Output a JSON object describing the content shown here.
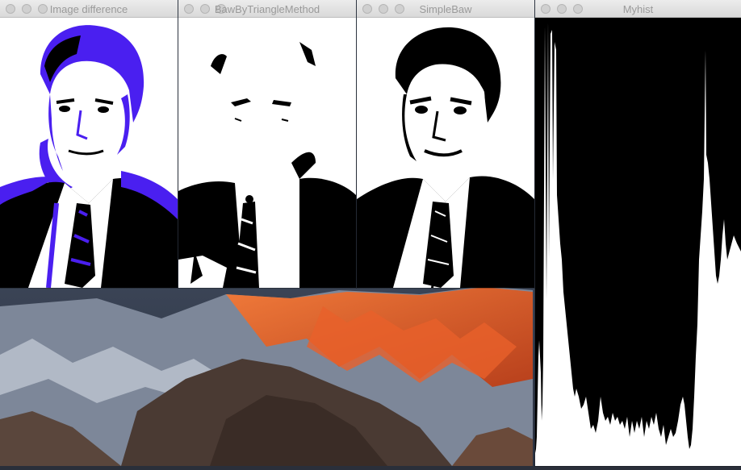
{
  "windows": [
    {
      "title": "Image difference",
      "image": "portrait-difference-blue-black"
    },
    {
      "title": "BawByTriangleMethod",
      "image": "portrait-triangle-threshold"
    },
    {
      "title": "SimpleBaw",
      "image": "portrait-simple-threshold"
    },
    {
      "title": "Myhist",
      "image": "grayscale-histogram"
    }
  ],
  "desktop": {
    "wallpaper": "mountain-sunset-wallpaper"
  },
  "colors": {
    "diff_fill": "#4a1ff0",
    "ink": "#000000",
    "paper": "#ffffff",
    "wallpaper_sky": "#3d4a5e",
    "wallpaper_glow": "#e8602a",
    "wallpaper_rock": "#4a3a33"
  }
}
